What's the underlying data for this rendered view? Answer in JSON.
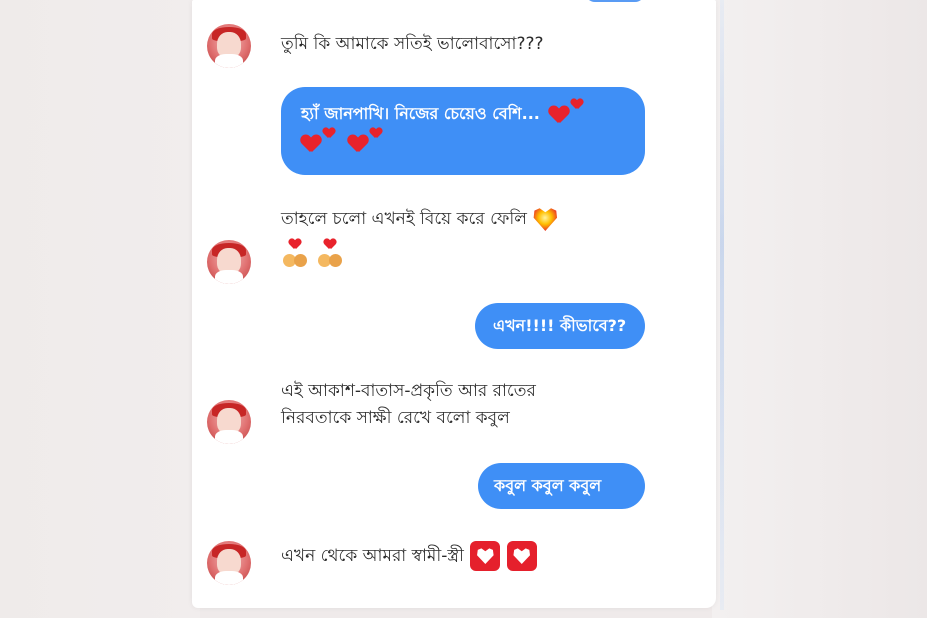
{
  "conversation": {
    "messages": [
      {
        "direction": "incoming",
        "text": "তুমি কি আমাকে সতিই ভালোবাসো???"
      },
      {
        "direction": "outgoing",
        "text": "হ্যাঁ জানপাখি। নিজের চেয়েও বেশি..."
      },
      {
        "direction": "incoming",
        "text": "তাহলে চলো এখনই বিয়ে করে ফেলি"
      },
      {
        "direction": "outgoing",
        "text": "এখন!!!! কীভাবে??"
      },
      {
        "direction": "incoming",
        "line1": "এই আকাশ-বাতাস-প্রকৃতি আর রাতের",
        "line2": "নিরবতাকে সাক্ষী রেখে বলো কবুল"
      },
      {
        "direction": "outgoing",
        "text": "কবুল কবুল কবুল"
      },
      {
        "direction": "incoming",
        "text": "এখন থেকে আমরা স্বামী-স্ত্রী"
      }
    ]
  },
  "colors": {
    "outgoing_bubble": "#3f8ff6",
    "heart": "#e8232c"
  },
  "icons": {
    "avatar": "profile-avatar",
    "heart": "red-heart-icon",
    "sparkling_heart": "heart-with-ribbon-icon",
    "couple": "couple-with-heart-icon",
    "boxed_heart": "heart-suit-box-icon"
  }
}
